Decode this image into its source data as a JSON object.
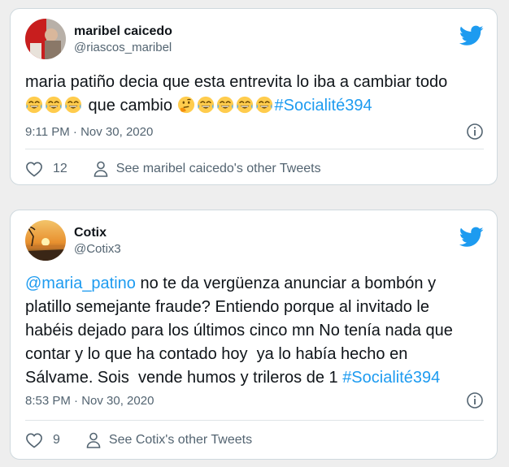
{
  "colors": {
    "link": "#1d9bf0",
    "secondary_text": "#536471",
    "twitter_blue": "#1d9bf0",
    "divider": "#dfe4e7"
  },
  "tweets": [
    {
      "author": {
        "display_name": "maribel caicedo",
        "handle": "@riascos_maribel",
        "avatar_icon": "avatar-photo-red-background"
      },
      "text_line1": "maria patiño decia que esta entrevita lo iba a cambiar todo",
      "text_middle": " que cambio ",
      "hashtag": "#Socialité394",
      "emojis_before": [
        "face-with-tears-of-joy",
        "face-with-tears-of-joy",
        "face-with-tears-of-joy"
      ],
      "emojis_after": [
        "thinking-face",
        "face-with-tears-of-joy",
        "face-with-tears-of-joy",
        "face-with-tears-of-joy",
        "face-with-tears-of-joy"
      ],
      "timestamp": "9:11 PM · Nov 30, 2020",
      "like_count": "12",
      "other_tweets_label": "See maribel caicedo's other Tweets"
    },
    {
      "author": {
        "display_name": "Cotix",
        "handle": "@Cotix3",
        "avatar_icon": "avatar-photo-sunset-beach"
      },
      "mention": "@maria_patino",
      "text_body": " no te da vergüenza anunciar a bombón y\nplatillo semejante fraude? Entiendo porque al invitado le\nhabéis dejado para los últimos cinco mn No tenía nada que\ncontar y lo que ha contado hoy  ya lo había hecho en\nSálvame. Sois  vende humos y trileros de 1 ",
      "hashtag": "#Socialité394",
      "timestamp": "8:53 PM · Nov 30, 2020",
      "like_count": "9",
      "other_tweets_label": "See Cotix's other Tweets"
    }
  ]
}
